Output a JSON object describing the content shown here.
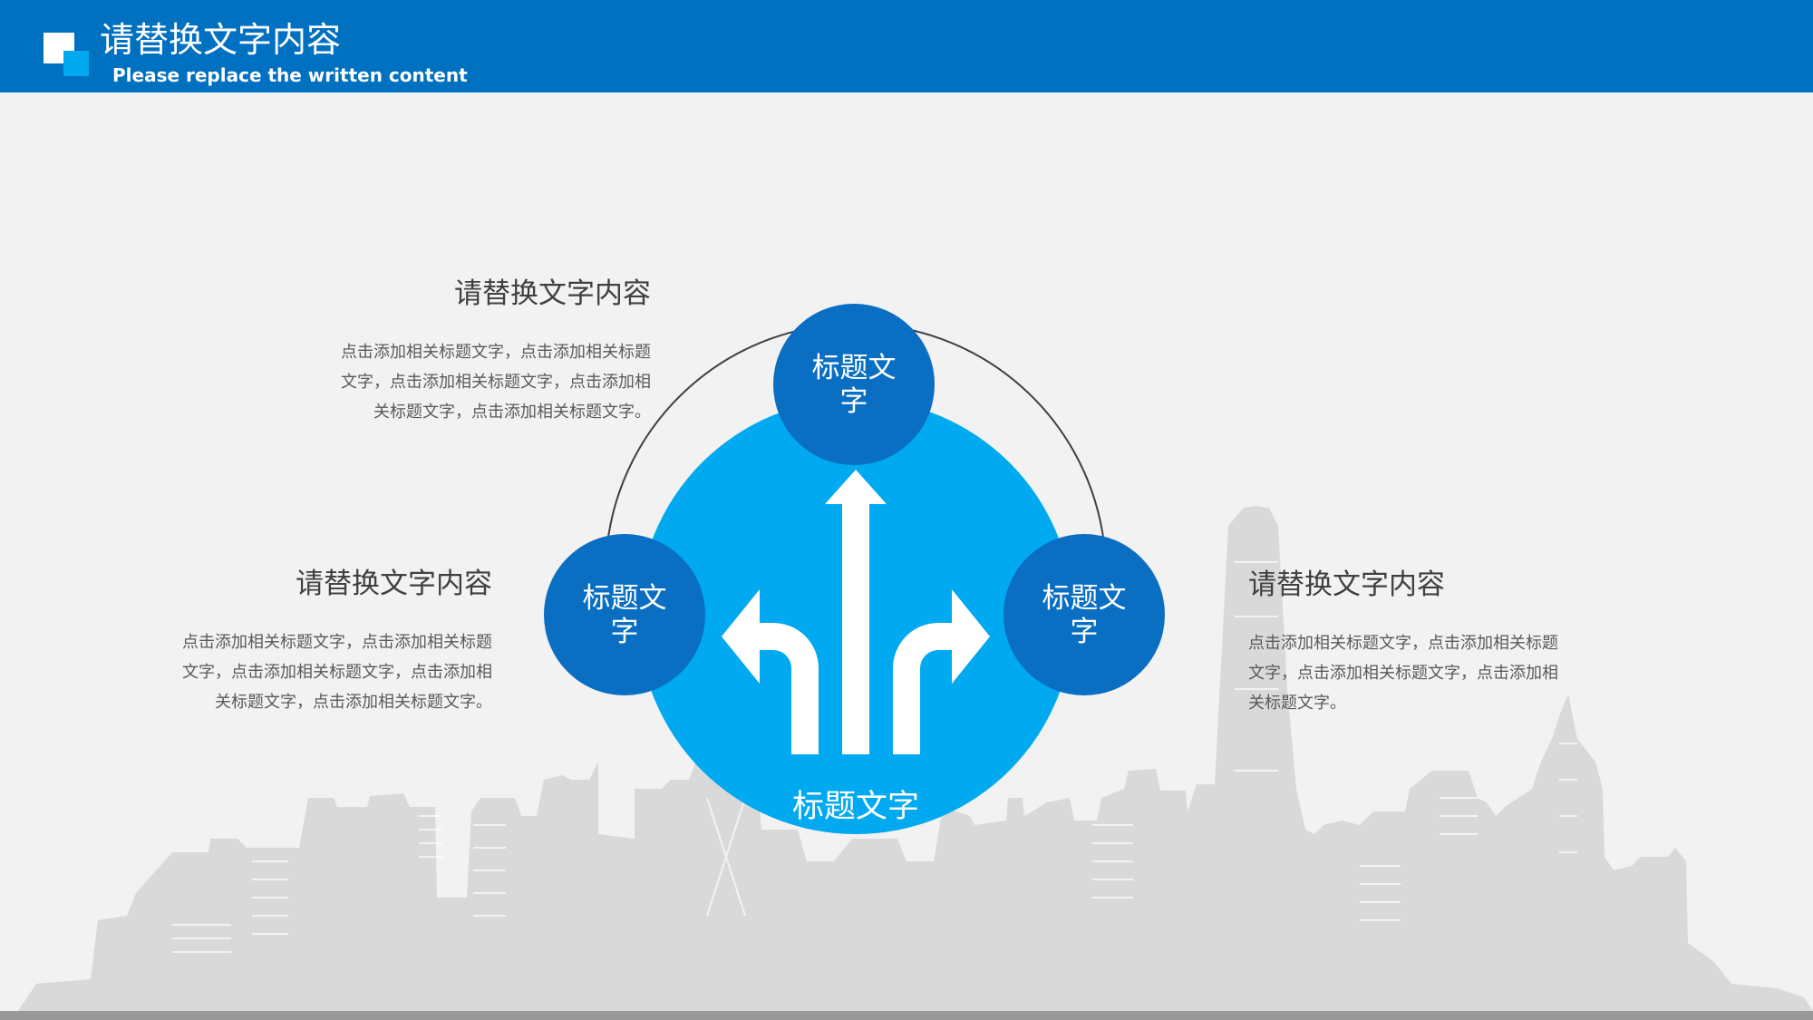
{
  "header": {
    "title": "请替换文字内容",
    "subtitle": "Please replace the written content"
  },
  "diagram": {
    "center_label": "标题文字",
    "nodes": [
      {
        "label": "标题文字"
      },
      {
        "label": "标题文字"
      },
      {
        "label": "标题文字"
      }
    ]
  },
  "blocks": [
    {
      "heading": "请替换文字内容",
      "text": "点击添加相关标题文字，点击添加相关标题文字，点击添加相关标题文字，点击添加相关标题文字，点击添加相关标题文字。"
    },
    {
      "heading": "请替换文字内容",
      "text": "点击添加相关标题文字，点击添加相关标题文字，点击添加相关标题文字，点击添加相关标题文字，点击添加相关标题文字。"
    },
    {
      "heading": "请替换文字内容",
      "text": "点击添加相关标题文字，点击添加相关标题文字，点击添加相关标题文字，点击添加相关标题文字。"
    }
  ],
  "colors": {
    "header_blue": "#0070c0",
    "light_blue": "#00a9f0",
    "node_blue": "#0a6ec3",
    "skyline_gray": "#d9d9d9"
  }
}
